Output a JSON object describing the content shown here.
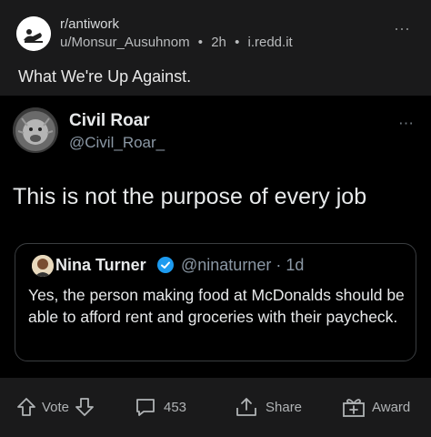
{
  "post": {
    "subreddit": "r/antiwork",
    "author": "u/Monsur_Ausuhnom",
    "separator": "•",
    "age": "2h",
    "domain": "i.redd.it",
    "title": "What We're Up Against.",
    "more_icon": "⋯"
  },
  "tweet": {
    "name": "Civil Roar",
    "handle": "@Civil_Roar_",
    "text": "This is not the purpose of every job",
    "more_icon": "⋯",
    "quote": {
      "name": "Nina Turner",
      "handle_age": "@ninaturner · 1d",
      "text": "Yes, the person making food at McDonalds should be able to afford rent and groceries with their paycheck."
    }
  },
  "actions": {
    "vote_label": "Vote",
    "comments_count": "453",
    "share_label": "Share",
    "award_label": "Award"
  }
}
